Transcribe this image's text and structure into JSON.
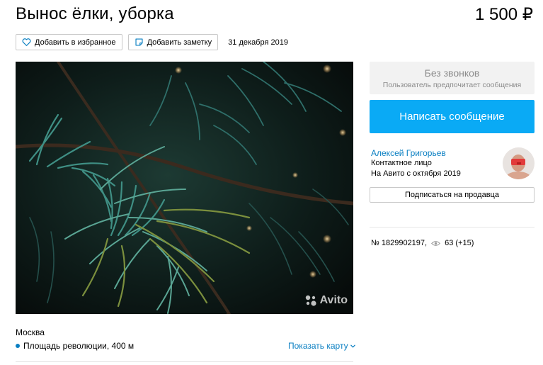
{
  "listing": {
    "title": "Вынос ёлки, уборка",
    "price": "1 500 ₽",
    "date": "31 декабря 2019"
  },
  "actions": {
    "favorite_label": "Добавить в избранное",
    "note_label": "Добавить заметку"
  },
  "photo": {
    "watermark": "Avito"
  },
  "location": {
    "city": "Москва",
    "metro": "Площадь революции, 400 м",
    "map_link": "Показать карту"
  },
  "contact": {
    "no_calls_title": "Без звонков",
    "no_calls_subtitle": "Пользователь предпочитает сообщения",
    "write_label": "Написать сообщение"
  },
  "seller": {
    "name": "Алексей Григорьев",
    "role": "Контактное лицо",
    "since": "На Авито с октября 2019",
    "subscribe_label": "Подписаться на продавца"
  },
  "meta": {
    "number": "№ 1829902197,",
    "views": "63 (+15)"
  },
  "colors": {
    "accent": "#0aaaf5",
    "link": "#0a7fc2"
  }
}
